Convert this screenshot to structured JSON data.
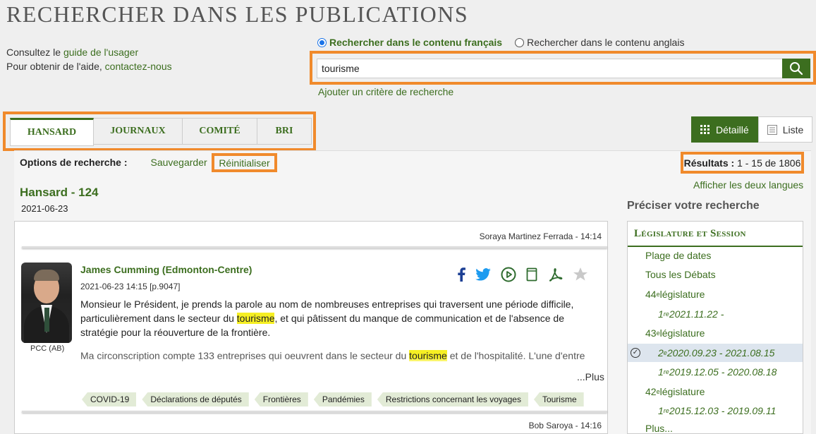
{
  "page": {
    "title": "RECHERCHER DANS LES PUBLICATIONS"
  },
  "help": {
    "line1_prefix": "Consultez le ",
    "line1_link": "guide de l'usager",
    "line2_prefix": "Pour obtenir de l'aide, ",
    "line2_link": "contactez-nous"
  },
  "search": {
    "radio_fr": "Rechercher dans le contenu français",
    "radio_en": "Rechercher dans le contenu anglais",
    "selected": "fr",
    "query": "tourisme",
    "add_criteria": "Ajouter un critère de recherche"
  },
  "tabs": [
    {
      "label": "HANSARD",
      "active": true
    },
    {
      "label": "JOURNAUX",
      "active": false
    },
    {
      "label": "COMITÉ",
      "active": false
    },
    {
      "label": "BRI",
      "active": false
    }
  ],
  "views": {
    "detailed": "Détaillé",
    "list": "Liste"
  },
  "options": {
    "label": "Options de recherche :",
    "save": "Sauvegarder",
    "reset": "Réinitialiser",
    "results_label": "Résultats :",
    "results_value": " 1 - 15 de 1806",
    "both_languages": "Afficher les deux langues"
  },
  "result": {
    "title": "Hansard - 124",
    "date": "2021-06-23",
    "top_speaker": "Soraya Martinez Ferrada - 14:14",
    "speaker_name": "James Cumming (Edmonton-Centre)",
    "speaker_time": "2021-06-23 14:15 [p.9047]",
    "party": "PCC (AB)",
    "para1_a": "Monsieur le Président, je prends la parole au nom de nombreuses entreprises qui traversent une période difficile, particulièrement dans le secteur du ",
    "para1_hl": "tourisme",
    "para1_b": ", et qui pâtissent du manque de communication et de l'absence de stratégie pour la réouverture de la frontière.",
    "para2_a": "Ma circonscription compte 133 entreprises qui oeuvrent dans le secteur du ",
    "para2_hl": "tourisme",
    "para2_b": " et de l'hospitalité. L'une d'entre elles, Trix Star Productions, dépend largement des revenus du trafic transfrontalier. Pour elle, il n'y aura pas de",
    "more": "...Plus",
    "tags": [
      "COVID-19",
      "Déclarations de députés",
      "Frontières",
      "Pandémies",
      "Restrictions concernant les voyages",
      "Tourisme"
    ],
    "next_speaker": "Bob Saroya - 14:16",
    "icons": [
      "facebook-icon",
      "twitter-icon",
      "play-icon",
      "bookmark-icon",
      "acrobat-icon",
      "star-icon"
    ]
  },
  "refine": {
    "title": "Préciser votre recherche",
    "box_title": "Législature et Session",
    "date_range": "Plage de dates",
    "all_debates": "Tous les Débats",
    "leg44_num": "44",
    "leg44_sup": "e",
    "leg44_txt": " législature",
    "s44_1_num": "1",
    "s44_1_sup": "re",
    "s44_1_txt": " 2021.11.22 -",
    "leg43_num": "43",
    "leg43_sup": "e",
    "leg43_txt": " législature",
    "s43_2_num": "2",
    "s43_2_sup": "e",
    "s43_2_txt": " 2020.09.23 - 2021.08.15",
    "s43_1_num": "1",
    "s43_1_sup": "re",
    "s43_1_txt": " 2019.12.05 - 2020.08.18",
    "leg42_num": "42",
    "leg42_sup": "e",
    "leg42_txt": " législature",
    "s42_1_num": "1",
    "s42_1_sup": "re",
    "s42_1_txt": " 2015.12.03 - 2019.09.11",
    "more": "Plus..."
  },
  "colors": {
    "brand_green": "#3c6e1f",
    "highlight_orange": "#f08a2c",
    "keyword_yellow": "#f6ef23"
  }
}
